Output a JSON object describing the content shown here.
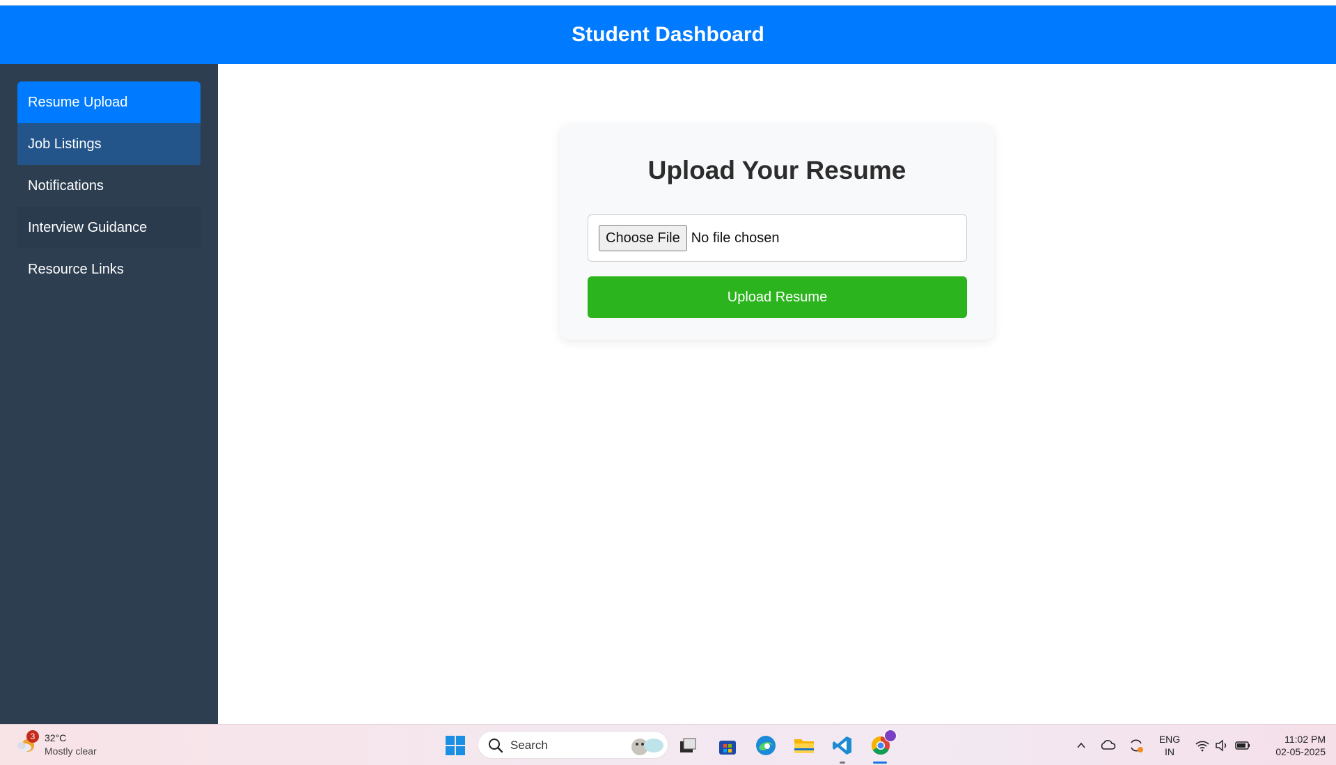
{
  "header": {
    "title": "Student Dashboard"
  },
  "sidebar": {
    "items": [
      {
        "label": "Resume Upload"
      },
      {
        "label": "Job Listings"
      },
      {
        "label": "Notifications"
      },
      {
        "label": "Interview Guidance"
      },
      {
        "label": "Resource Links"
      }
    ]
  },
  "card": {
    "title": "Upload Your Resume",
    "choose_label": "Choose File",
    "file_status": "No file chosen",
    "upload_label": "Upload Resume"
  },
  "taskbar": {
    "weather_badge": "3",
    "weather_temp": "32°C",
    "weather_desc": "Mostly clear",
    "search_label": "Search",
    "lang_line1": "ENG",
    "lang_line2": "IN",
    "time": "11:02 PM",
    "date": "02-05-2025"
  },
  "colors": {
    "header": "#007bff",
    "sidebar": "#2c3e50",
    "active_item": "#007bff",
    "upload_button": "#2cb41e"
  }
}
